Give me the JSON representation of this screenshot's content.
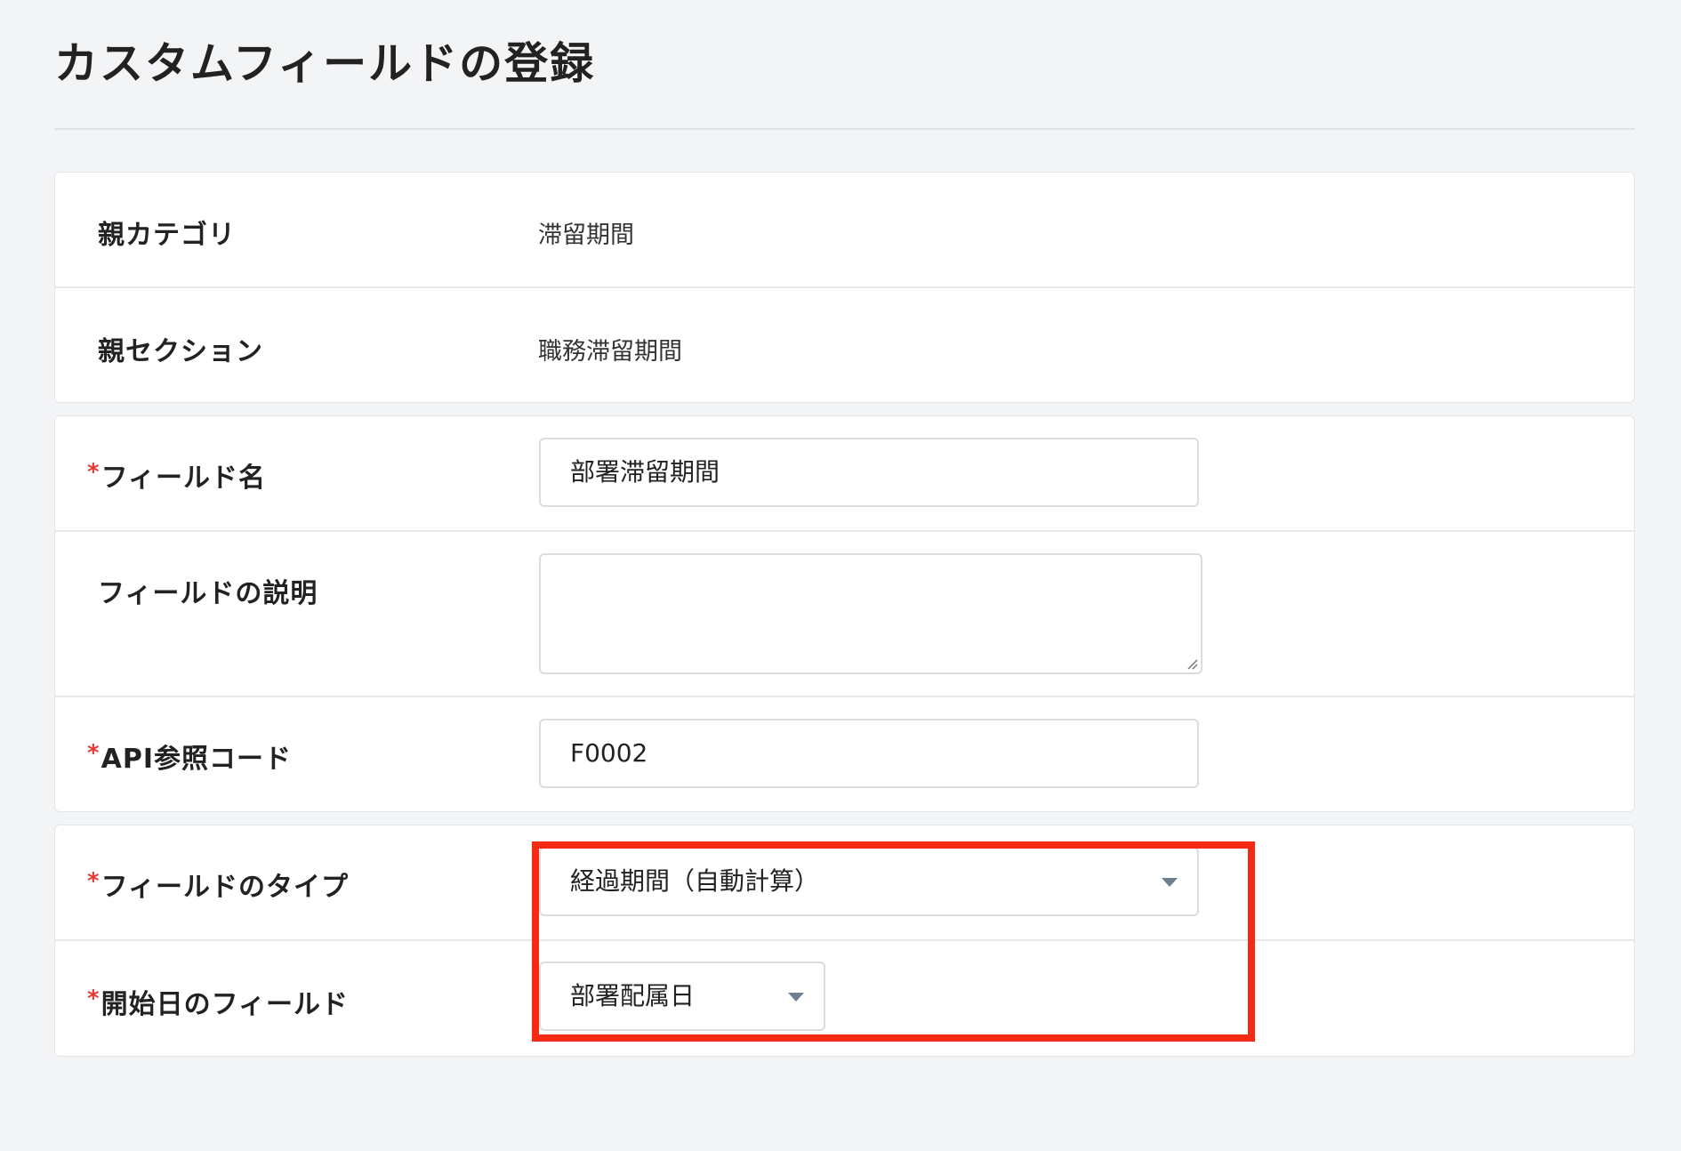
{
  "page": {
    "title": "カスタムフィールドの登録"
  },
  "info": {
    "parent_category": {
      "label": "親カテゴリ",
      "value": "滞留期間"
    },
    "parent_section": {
      "label": "親セクション",
      "value": "職務滞留期間"
    }
  },
  "form": {
    "required_mark": "*",
    "field_name": {
      "label": "フィールド名",
      "value": "部署滞留期間"
    },
    "field_description": {
      "label": "フィールドの説明",
      "value": ""
    },
    "api_code": {
      "label": "API参照コード",
      "value": "F0002"
    },
    "field_type": {
      "label": "フィールドのタイプ",
      "selected": "経過期間（自動計算）"
    },
    "start_date_field": {
      "label": "開始日のフィールド",
      "selected": "部署配属日"
    }
  },
  "colors": {
    "highlight": "#f52a14",
    "required": "#e53935",
    "caret": "#6f7f92",
    "background": "#f3f4f6"
  },
  "icons": {
    "dropdown": "caret-down-icon",
    "resize": "resize-grip-icon"
  }
}
